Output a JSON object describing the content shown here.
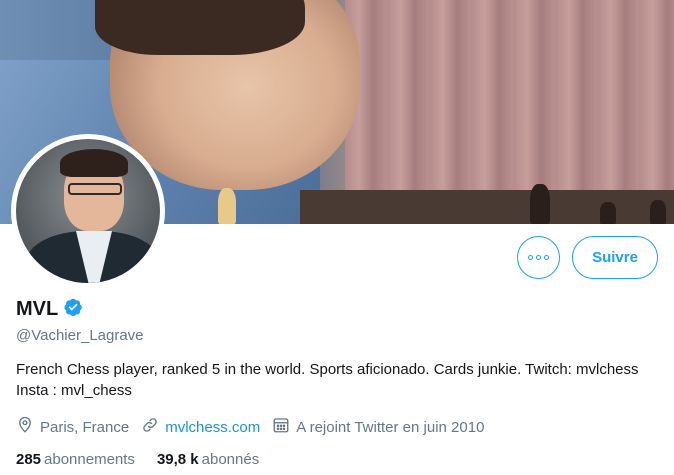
{
  "header": {
    "banner_icon": "cover-photo",
    "avatar_icon": "profile-photo"
  },
  "actions": {
    "more_icon": "more-options-icon",
    "follow_label": "Suivre"
  },
  "profile": {
    "name": "MVL",
    "verified_icon": "verified-badge-icon",
    "handle": "@Vachier_Lagrave",
    "bio": "French Chess player, ranked 5 in the world. Sports aficionado. Cards junkie. Twitch: mvlchess Insta : mvl_chess",
    "location": "Paris, France",
    "website": "mvlchess.com",
    "joined": "A rejoint Twitter en juin 2010"
  },
  "stats": {
    "following_count": "285",
    "following_label": "abonnements",
    "followers_count": "39,8 k",
    "followers_label": "abonnés"
  },
  "colors": {
    "accent": "#1da1f2",
    "link": "#1b95e0",
    "secondary_text": "#657786",
    "primary_text": "#14171a"
  }
}
